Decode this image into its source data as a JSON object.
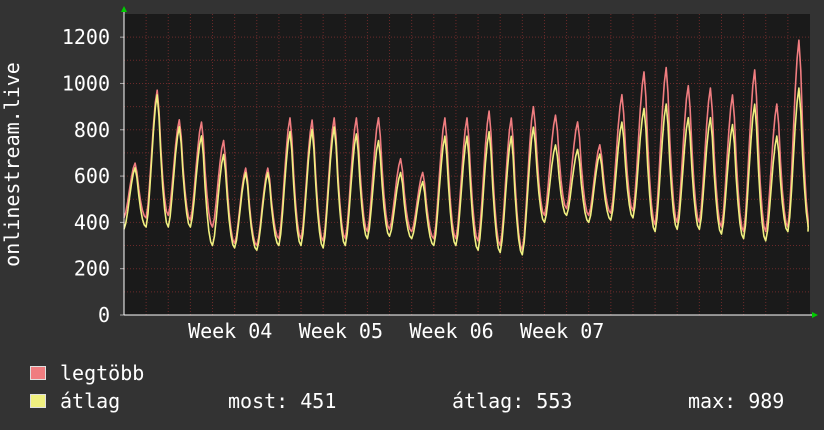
{
  "chart_data": {
    "type": "line",
    "title": "",
    "ylabel": "onlinestream.live",
    "xlabel": "",
    "ylim": [
      0,
      1300
    ],
    "y_ticks": [
      "0",
      "200",
      "400",
      "600",
      "800",
      "1000",
      "1200"
    ],
    "x_ticks": [
      "Week 04",
      "Week 05",
      "Week 06",
      "Week 07"
    ],
    "grid": true,
    "legend_placement": "bottom-left",
    "colors": {
      "background": "#333333",
      "plot_background": "#1a1a1a",
      "grid": "#6b2a2a",
      "axis": "#ffffff",
      "arrow": "#00cc00"
    },
    "days": 31,
    "series": [
      {
        "name": "legtöbb",
        "color": "#f07d80",
        "peaks": [
          660,
          980,
          850,
          840,
          760,
          640,
          640,
          860,
          850,
          860,
          860,
          860,
          680,
          620,
          860,
          860,
          890,
          860,
          910,
          870,
          840,
          740,
          960,
          1060,
          1080,
          1000,
          990,
          960,
          1070,
          920,
          1200
        ],
        "troughs": [
          420,
          420,
          430,
          410,
          380,
          310,
          300,
          330,
          330,
          320,
          330,
          360,
          370,
          360,
          330,
          330,
          320,
          300,
          280,
          430,
          460,
          430,
          440,
          450,
          390,
          400,
          400,
          380,
          360,
          360,
          380
        ]
      },
      {
        "name": "átlag",
        "color": "#f0f080",
        "peaks": [
          640,
          960,
          820,
          780,
          700,
          620,
          620,
          800,
          810,
          820,
          790,
          760,
          620,
          580,
          780,
          780,
          800,
          780,
          820,
          740,
          720,
          700,
          840,
          900,
          920,
          860,
          860,
          830,
          920,
          780,
          990
        ],
        "troughs": [
          370,
          380,
          380,
          380,
          300,
          290,
          280,
          300,
          300,
          290,
          300,
          330,
          340,
          330,
          300,
          300,
          280,
          270,
          260,
          400,
          430,
          400,
          410,
          420,
          360,
          370,
          370,
          350,
          330,
          320,
          360
        ]
      }
    ]
  },
  "legend": {
    "max_label": "legtöbb",
    "avg_label": "átlag",
    "max_color": "#f07d80",
    "avg_color": "#f0f080"
  },
  "stats": {
    "now": "most: 451",
    "average": "átlag: 553",
    "max": "max: 989"
  }
}
